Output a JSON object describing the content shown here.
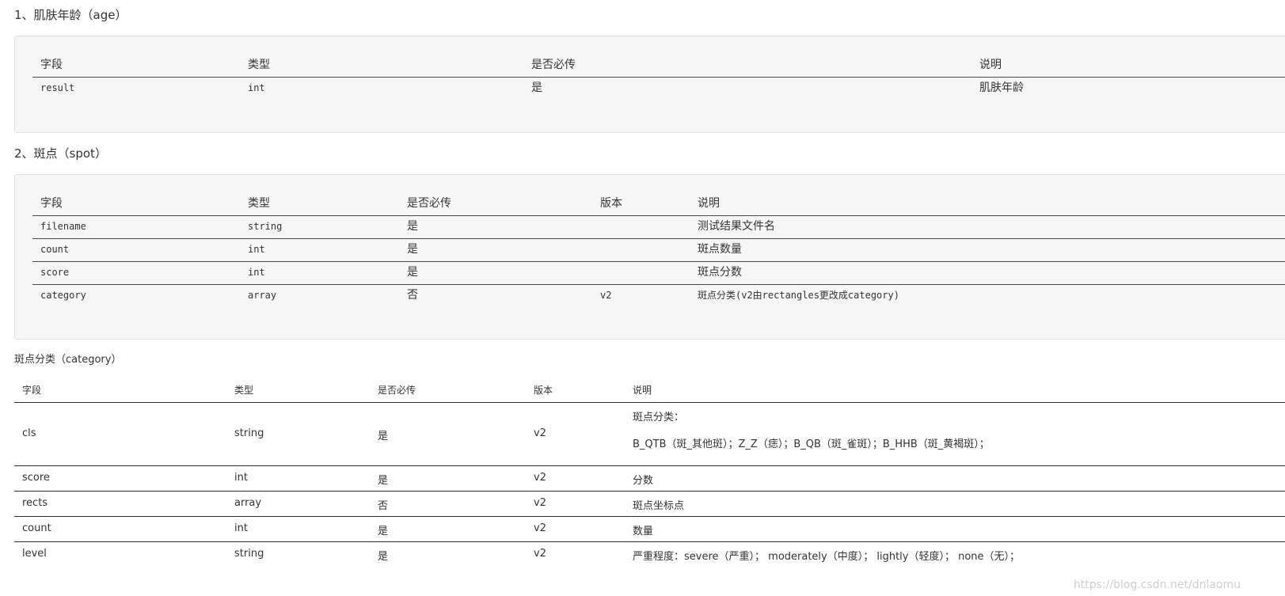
{
  "section1": {
    "title": "1、肌肤年龄（age）",
    "headers": [
      "字段",
      "类型",
      "是否必传",
      "说明"
    ],
    "rows": [
      [
        "result",
        "int",
        "是",
        "肌肤年龄"
      ]
    ]
  },
  "section2": {
    "title": "2、斑点（spot）",
    "headers": [
      "字段",
      "类型",
      "是否必传",
      "版本",
      "说明"
    ],
    "rows": [
      [
        "filename",
        "string",
        "是",
        "",
        "测试结果文件名"
      ],
      [
        "count",
        "int",
        "是",
        "",
        "斑点数量"
      ],
      [
        "score",
        "int",
        "是",
        "",
        "斑点分数"
      ],
      [
        "category",
        "array",
        "否",
        "v2",
        "斑点分类(v2由rectangles更改成category)"
      ]
    ]
  },
  "section3": {
    "caption": "斑点分类（category）",
    "headers": [
      "字段",
      "类型",
      "是否必传",
      "版本",
      "说明"
    ],
    "rows": [
      [
        "cls",
        "string",
        "是",
        "v2",
        "斑点分类：",
        "B_QTB（斑_其他斑）；Z_Z（痣）；B_QB（斑_雀斑）；B_HHB（斑_黄褐斑）；"
      ],
      [
        "score",
        "int",
        "是",
        "v2",
        "分数"
      ],
      [
        "rects",
        "array",
        "否",
        "v2",
        "斑点坐标点"
      ],
      [
        "count",
        "int",
        "是",
        "v2",
        "数量"
      ],
      [
        "level",
        "string",
        "是",
        "v2",
        "严重程度：severe（严重）； moderately（中度）； lightly（轻度）； none（无）；"
      ]
    ]
  },
  "watermark": "https://blog.csdn.net/dnlaomu"
}
